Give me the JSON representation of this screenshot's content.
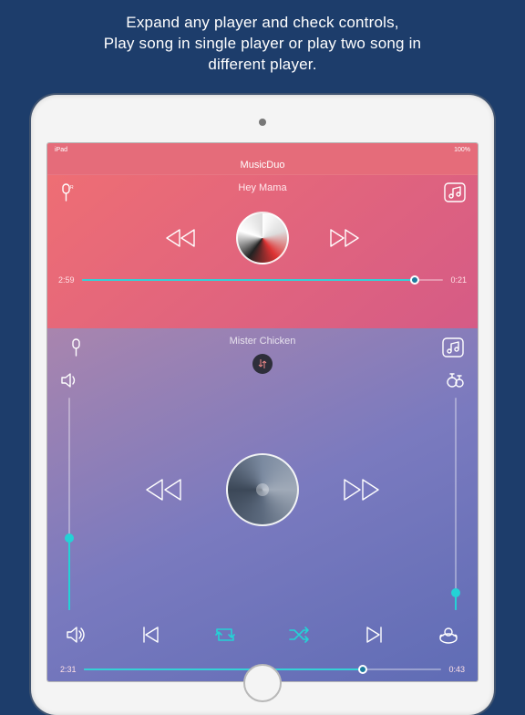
{
  "caption": "Expand any player and check controls,\nPlay song in single player or play two song in\ndifferent player.",
  "app_title": "MusicDuo",
  "status": {
    "carrier": "iPad",
    "battery": "100%"
  },
  "top_player": {
    "song_title": "Hey Mama",
    "time_elapsed": "2:59",
    "time_remaining": "0:21"
  },
  "bottom_player": {
    "song_title": "Mister Chicken",
    "time_elapsed": "2:31",
    "time_remaining": "0:43"
  }
}
